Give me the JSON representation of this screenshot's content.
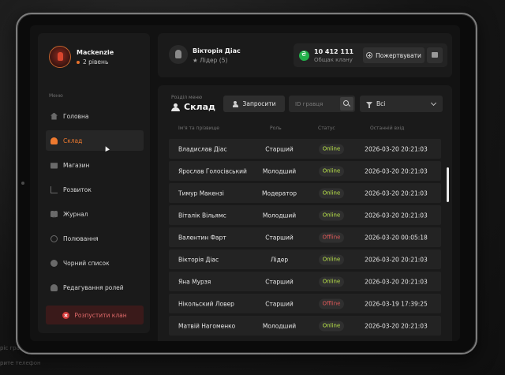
{
  "background": {
    "left_texts": [
      "ріс грав",
      "рите телефон"
    ]
  },
  "user": {
    "name": "Mackenzie",
    "level": "2 рівень"
  },
  "menu": {
    "title": "Меню",
    "items": [
      {
        "label": "Головна",
        "icon": "home-icon"
      },
      {
        "label": "Склад",
        "icon": "people-icon",
        "active": true
      },
      {
        "label": "Магазин",
        "icon": "store-icon"
      },
      {
        "label": "Розвиток",
        "icon": "growth-icon"
      },
      {
        "label": "Журнал",
        "icon": "journal-icon"
      },
      {
        "label": "Полювання",
        "icon": "hunt-icon"
      },
      {
        "label": "Чорний список",
        "icon": "blacklist-icon"
      },
      {
        "label": "Редагування ролей",
        "icon": "roles-icon"
      }
    ],
    "disband_label": "Розпустити клан"
  },
  "leader": {
    "name": "Вікторія Діас",
    "role": "Лідер (5)"
  },
  "clan": {
    "balance": "10 412 111",
    "balance_label": "Общак клану",
    "donate_label": "Пожертвувати"
  },
  "section": {
    "label": "Розділ меню",
    "title": "Склад",
    "invite_label": "Запросити",
    "search_placeholder": "ID гравця",
    "filter_value": "Всі"
  },
  "table": {
    "columns": [
      "Ім'я та прізвище",
      "Роль",
      "Статус",
      "Останній вхід"
    ],
    "rows": [
      {
        "name": "Владислав Діас",
        "role": "Старший",
        "status": "Online",
        "last": "2026-03-20 20:21:03"
      },
      {
        "name": "Ярослав Голосівський",
        "role": "Молодший",
        "status": "Online",
        "last": "2026-03-20 20:21:03"
      },
      {
        "name": "Тимур Макензі",
        "role": "Модератор",
        "status": "Online",
        "last": "2026-03-20 20:21:03"
      },
      {
        "name": "Віталік Вільямс",
        "role": "Молодший",
        "status": "Online",
        "last": "2026-03-20 20:21:03"
      },
      {
        "name": "Валентин Фарт",
        "role": "Старший",
        "status": "Offline",
        "last": "2026-03-20 00:05:18"
      },
      {
        "name": "Вікторія Діас",
        "role": "Лідер",
        "status": "Online",
        "last": "2026-03-20 20:21:03"
      },
      {
        "name": "Яна Мурзя",
        "role": "Старший",
        "status": "Online",
        "last": "2026-03-20 20:21:03"
      },
      {
        "name": "Нікольский Ловер",
        "role": "Старший",
        "status": "Offline",
        "last": "2026-03-19 17:39:25"
      },
      {
        "name": "Матвій Нагоменко",
        "role": "Молодший",
        "status": "Online",
        "last": "2026-03-20 20:21:03"
      }
    ]
  },
  "colors": {
    "accent": "#ef7a2f",
    "online": "#b9e34a",
    "offline": "#e05a5a",
    "balance_coin": "#22b04a",
    "danger": "#d53b3b"
  }
}
